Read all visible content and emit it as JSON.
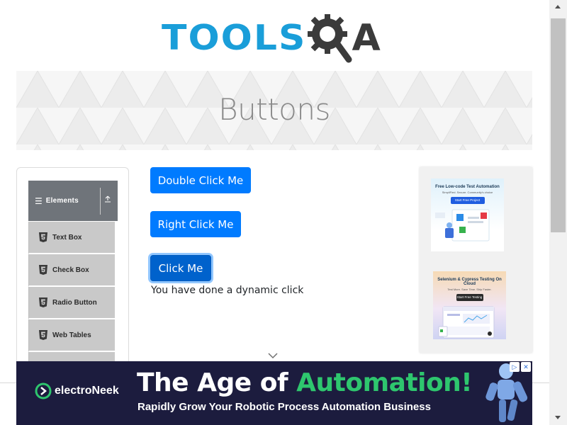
{
  "header": {
    "logo_text_primary": "TOOLS",
    "logo_text_secondary": "A",
    "logo_icon": "gear-magnifier-icon",
    "colors": {
      "primary": "#1a9ed9",
      "secondary": "#3b3b3b"
    }
  },
  "banner": {
    "title": "Buttons"
  },
  "sidebar": {
    "group": {
      "label": "Elements",
      "menu_icon": "hamburger-icon",
      "collapse_icon": "collapse-up-icon"
    },
    "items": [
      {
        "label": "Text Box",
        "icon": "html5-icon"
      },
      {
        "label": "Check Box",
        "icon": "html5-icon"
      },
      {
        "label": "Radio Button",
        "icon": "html5-icon"
      },
      {
        "label": "Web Tables",
        "icon": "html5-icon"
      }
    ]
  },
  "main": {
    "buttons": {
      "double_click": "Double Click Me",
      "right_click": "Right Click Me",
      "click": "Click Me"
    },
    "dynamic_click_message": "You have done a dynamic click",
    "scroll_hint_icon": "chevron-down-icon",
    "colors": {
      "button": "#007bff",
      "button_active": "#0062cc"
    }
  },
  "ads": {
    "ad1": {
      "title": "Free Low-code Test Automation",
      "subtitle": "SimpliFied. Secure. Community's choice",
      "cta": "Start Free Project"
    },
    "ad2": {
      "title": "Selenium & Cypress Testing On Cloud",
      "subtitle": "Test More. Save Time. Ship Faster.",
      "cta": "Start Free Testing"
    }
  },
  "bottom_ad": {
    "brand": "electroNeek",
    "headline_prefix": "The Age of ",
    "headline_accent": "Automation!",
    "subline": "Rapidly Grow Your Robotic Process Automation Business",
    "adchoices_icon": "adchoices-icon",
    "close_icon": "close-icon",
    "colors": {
      "background": "#1c1c3e",
      "accent": "#2ec66e"
    }
  }
}
